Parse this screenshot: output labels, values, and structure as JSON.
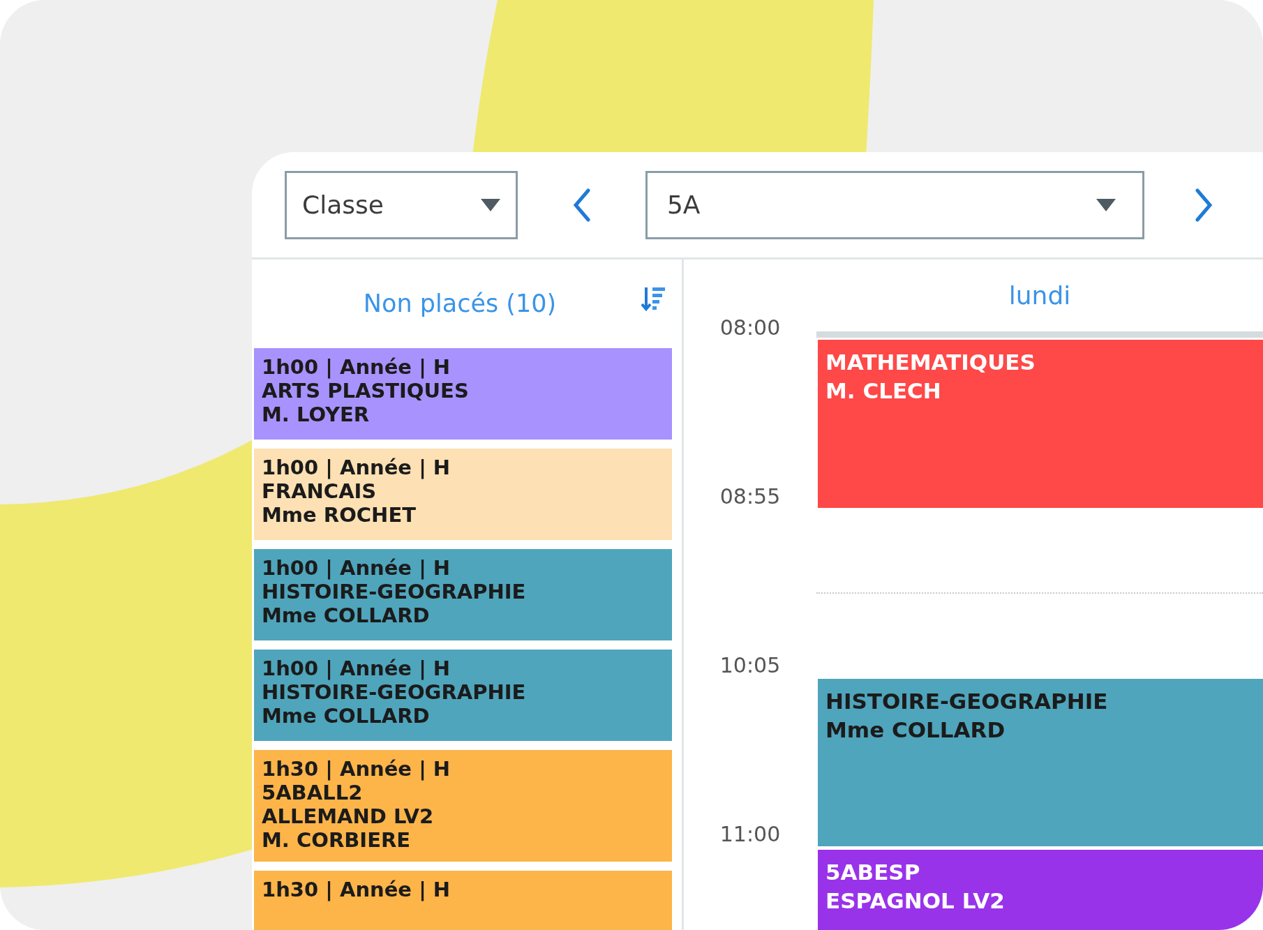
{
  "toolbar": {
    "type_select": {
      "value": "Classe"
    },
    "group_select": {
      "value": "5A"
    }
  },
  "unplaced": {
    "title": "Non placés (10)",
    "cards": [
      {
        "lines": [
          "1h00 | Année | H",
          "ARTS PLASTIQUES",
          "M. LOYER"
        ],
        "color": "#a892fd"
      },
      {
        "lines": [
          "1h00 | Année | H",
          "FRANCAIS",
          "Mme ROCHET"
        ],
        "color": "#fde0b3"
      },
      {
        "lines": [
          "1h00 | Année | H",
          "HISTOIRE-GEOGRAPHIE",
          "Mme COLLARD"
        ],
        "color": "#4fa5bc"
      },
      {
        "lines": [
          "1h00 | Année | H",
          "HISTOIRE-GEOGRAPHIE",
          "Mme COLLARD"
        ],
        "color": "#4fa5bc"
      },
      {
        "lines": [
          "1h30 | Année | H",
          "5ABALL2",
          "ALLEMAND LV2",
          "M. CORBIERE"
        ],
        "color": "#fdb449"
      },
      {
        "lines": [
          "1h30 | Année | H"
        ],
        "color": "#fdb449"
      }
    ]
  },
  "day": {
    "label": "lundi",
    "times": [
      "08:00",
      "08:55",
      "10:05",
      "11:00"
    ],
    "lessons": [
      {
        "lines": [
          "MATHEMATIQUES",
          "M. CLECH"
        ],
        "color": "#ff4848"
      },
      {
        "lines": [
          "HISTOIRE-GEOGRAPHIE",
          "Mme COLLARD"
        ],
        "color": "#4fa5bc"
      },
      {
        "lines": [
          "5ABESP",
          "ESPAGNOL LV2"
        ],
        "color": "#9933ea"
      }
    ]
  }
}
